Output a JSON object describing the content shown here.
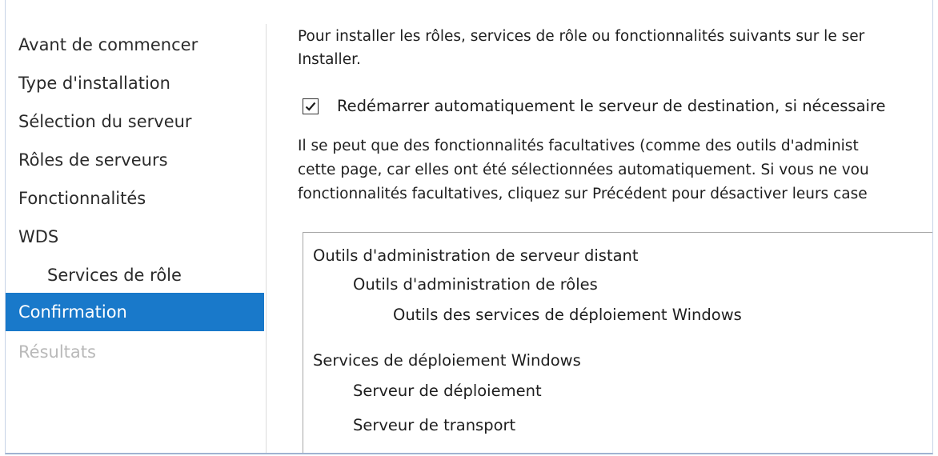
{
  "nav": {
    "items": [
      {
        "label": "Avant de commencer"
      },
      {
        "label": "Type d'installation"
      },
      {
        "label": "Sélection du serveur"
      },
      {
        "label": "Rôles de serveurs"
      },
      {
        "label": "Fonctionnalités"
      },
      {
        "label": "WDS"
      },
      {
        "label": "Services de rôle"
      },
      {
        "label": "Confirmation"
      },
      {
        "label": "Résultats"
      }
    ],
    "active_index": 7,
    "active_color": "#1979ca"
  },
  "main": {
    "intro_line1": "Pour installer les rôles, services de rôle ou fonctionnalités suivants sur le ser",
    "intro_line2": "Installer.",
    "restart_checkbox": {
      "label": "Redémarrer automatiquement le serveur de destination, si nécessaire",
      "checked": true
    },
    "info_line1": "Il se peut que des fonctionnalités facultatives (comme des outils d'administ",
    "info_line2": "cette page, car elles ont été sélectionnées automatiquement. Si vous ne vou",
    "info_line3": "fonctionnalités facultatives, cliquez sur Précédent pour désactiver leurs case",
    "features": [
      {
        "label": "Outils d'administration de serveur distant"
      },
      {
        "label": "Outils d'administration de rôles"
      },
      {
        "label": "Outils des services de déploiement Windows"
      },
      {
        "label": "Services de déploiement Windows"
      },
      {
        "label": "Serveur de déploiement"
      },
      {
        "label": "Serveur de transport"
      }
    ]
  }
}
